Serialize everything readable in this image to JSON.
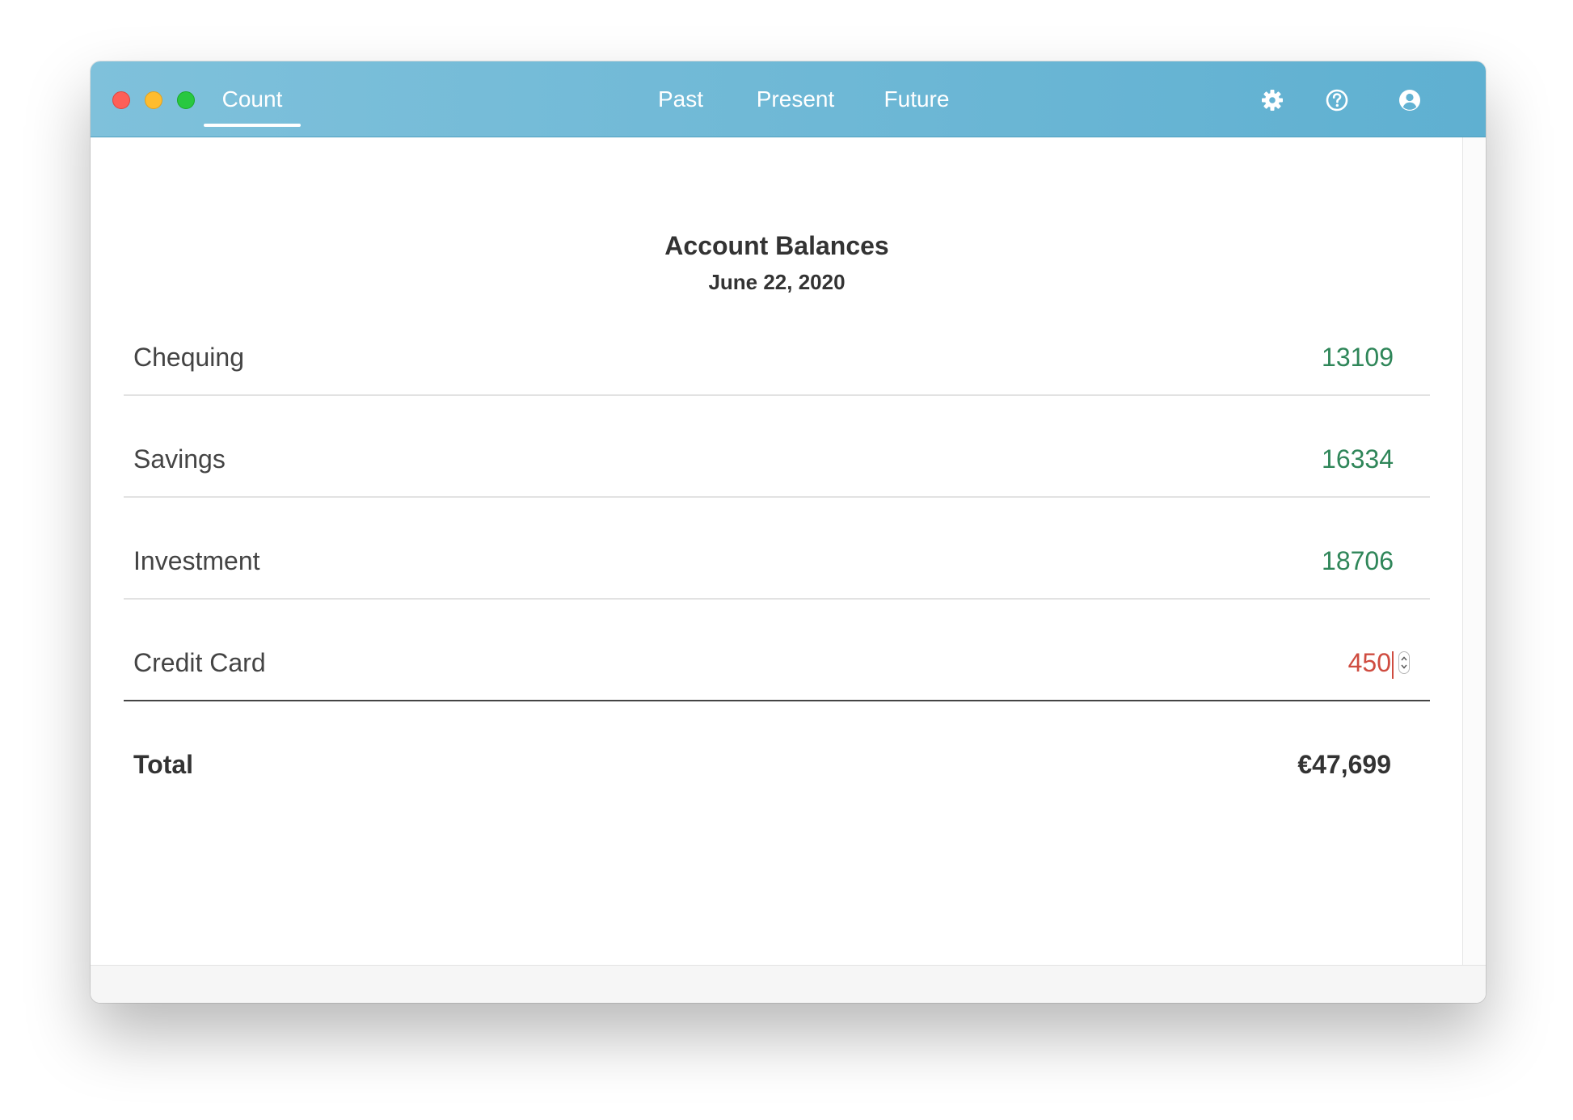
{
  "window": {
    "traffic_lights": [
      "close",
      "minimize",
      "maximize"
    ]
  },
  "nav": {
    "app_tab": "Count",
    "tabs": [
      "Past",
      "Present",
      "Future"
    ],
    "icons": [
      "gear-icon",
      "help-circle-icon",
      "user-circle-icon"
    ]
  },
  "page": {
    "title": "Account Balances",
    "date": "June 22, 2020"
  },
  "accounts": [
    {
      "label": "Chequing",
      "value": "13109",
      "color": "#2f8659"
    },
    {
      "label": "Savings",
      "value": "16334",
      "color": "#2f8659"
    },
    {
      "label": "Investment",
      "value": "18706",
      "color": "#2f8659"
    },
    {
      "label": "Credit Card",
      "value": "450",
      "color": "#cf4c40"
    }
  ],
  "total": {
    "label": "Total",
    "value": "€47,699"
  },
  "colors": {
    "titlebar_accent": "#6ab6d6",
    "positive": "#2f8659",
    "negative": "#cf4c40"
  }
}
